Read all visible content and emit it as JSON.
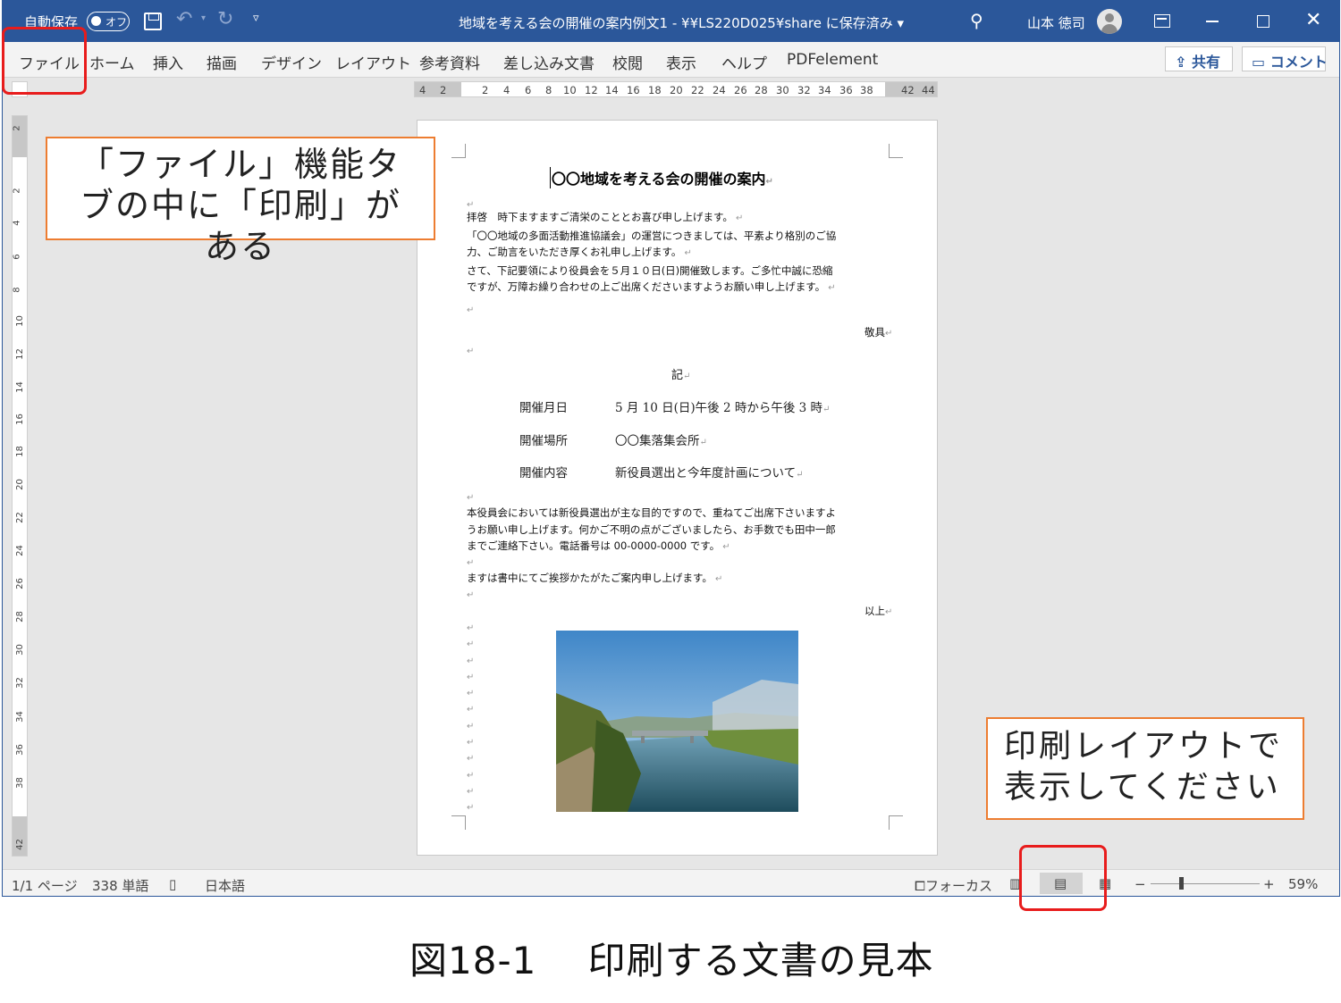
{
  "titlebar": {
    "autosave_label": "自動保存",
    "autosave_state": "オフ",
    "document_title": "地域を考える会の開催の案内例文1  -  ¥¥LS220D025¥share に保存済み  ▾",
    "user_name": "山本 徳司"
  },
  "ribbon": {
    "tabs": [
      "ファイル",
      "ホーム",
      "挿入",
      "描画",
      "デザイン",
      "レイアウト",
      "参考資料",
      "差し込み文書",
      "校閲",
      "表示",
      "ヘルプ",
      "PDFelement"
    ],
    "share_label": "共有",
    "comment_label": "コメント"
  },
  "ruler": {
    "horizontal": [
      "4",
      "2",
      "2",
      "4",
      "6",
      "8",
      "10",
      "12",
      "14",
      "16",
      "18",
      "20",
      "22",
      "24",
      "26",
      "28",
      "30",
      "32",
      "34",
      "36",
      "38",
      "42",
      "44"
    ],
    "vertical": [
      "2",
      "2",
      "4",
      "6",
      "8",
      "10",
      "12",
      "14",
      "16",
      "18",
      "20",
      "22",
      "24",
      "26",
      "28",
      "30",
      "32",
      "34",
      "36",
      "38",
      "42"
    ]
  },
  "document": {
    "title": "〇〇地域を考える会の開催の案内",
    "para1": [
      "拝啓　時下ますますご清栄のこととお喜び申し上げます。",
      "「〇〇地域の多面活動推進協議会」の運営につきましては、平素より格別のご協",
      "力、ご助言をいただき厚くお礼申し上げます。",
      "さて、下記要領により役員会を５月１０日(日)開催致します。ご多忙中誠に恐縮",
      "ですが、万障お繰り合わせの上ご出席くださいますようお願い申し上げます。"
    ],
    "keigu": "敬具",
    "ki": "記",
    "details": [
      {
        "label": "開催月日",
        "value": "5 月 10 日(日)午後 2 時から午後 3 時"
      },
      {
        "label": "開催場所",
        "value": "〇〇集落集会所"
      },
      {
        "label": "開催内容",
        "value": "新役員選出と今年度計画について"
      }
    ],
    "para2": [
      "本役員会においては新役員選出が主な目的ですので、重ねてご出席下さいますよ",
      "うお願い申し上げます。何かご不明の点がございましたら、お手数でも田中一郎",
      "までご連絡下さい。電話番号は 00-0000-0000 です。"
    ],
    "para3": "ますは書中にてご挨拶かたがたご案内申し上げます。",
    "ijo": "以上"
  },
  "statusbar": {
    "page": "1/1 ページ",
    "words": "338 単語",
    "language": "日本語",
    "focus": "フォーカス",
    "zoom": "59%",
    "zoom_minus": "−",
    "zoom_plus": "+"
  },
  "annotations": {
    "callout_file": "「ファイル」機能タブの中に「印刷」がある",
    "callout_layout": "印刷レイアウトで表示してください"
  },
  "caption": "図18-1　 印刷する文書の見本"
}
